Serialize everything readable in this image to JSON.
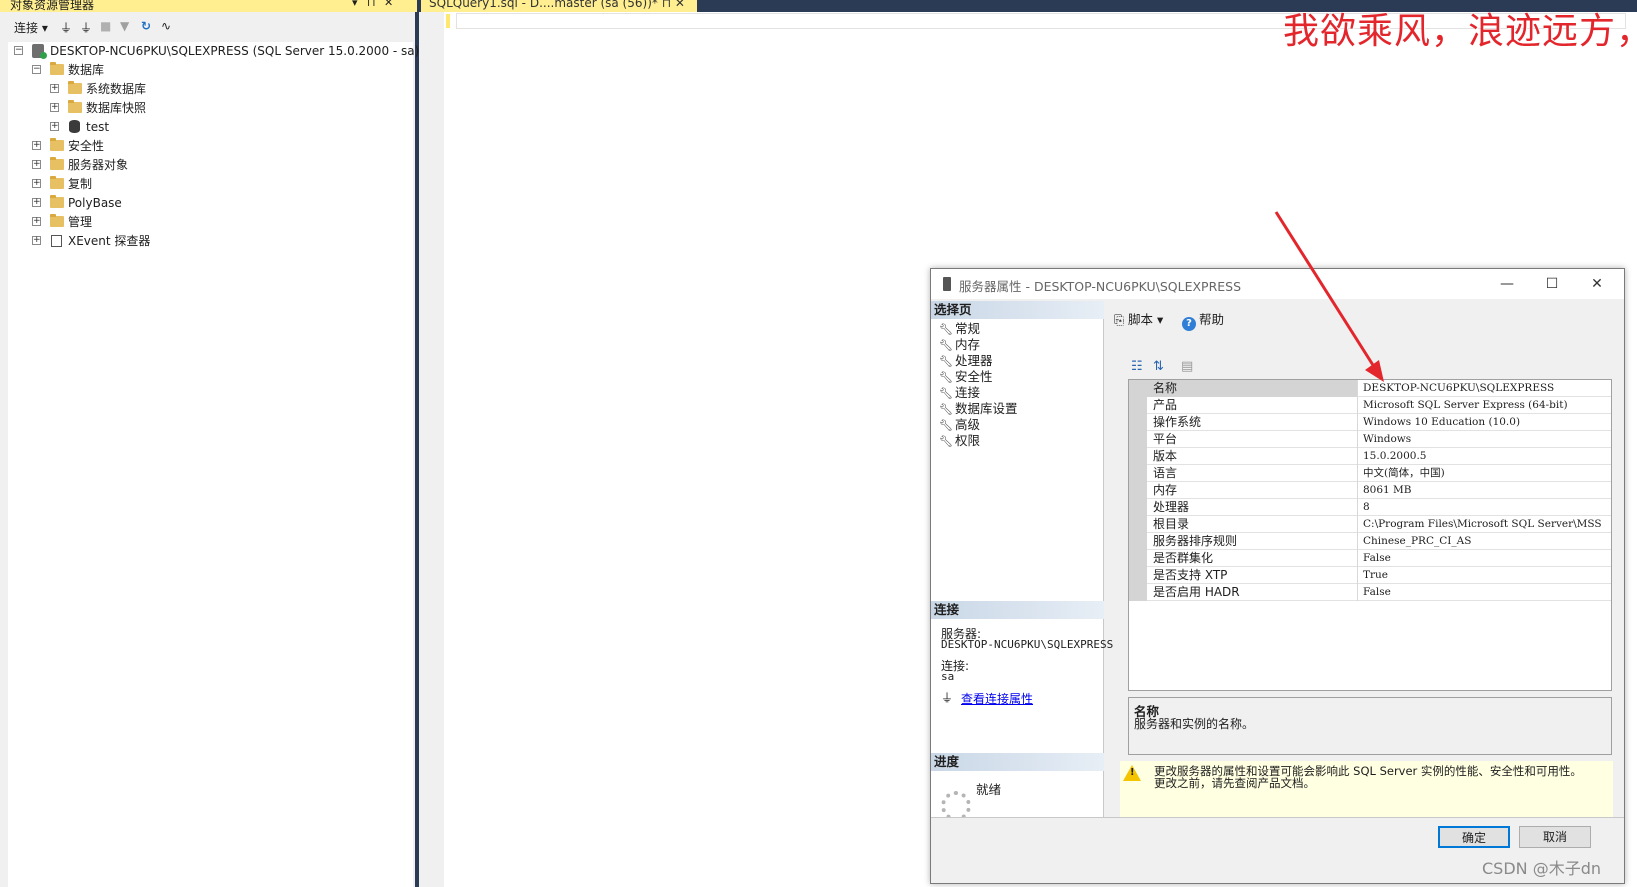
{
  "object_explorer": {
    "title": "对象资源管理器",
    "controls": [
      "▾",
      "⊓",
      "✕"
    ],
    "toolbar": {
      "connect_label": "连接 ▾"
    },
    "tree": {
      "server": "DESKTOP-NCU6PKU\\SQLEXPRESS (SQL Server 15.0.2000 - sa)",
      "databases": "数据库",
      "system_db": "系统数据库",
      "snapshots": "数据库快照",
      "test_db": "test",
      "security": "安全性",
      "server_objects": "服务器对象",
      "replication": "复制",
      "polybase": "PolyBase",
      "management": "管理",
      "xevent": "XEvent 探查器"
    }
  },
  "editor": {
    "tab_label": "SQLQuery1.sql - D....master (sa (56))*  ⊓  ✕"
  },
  "watermark": "我欲乘风，浪迹远方，",
  "csdn": "CSDN @木子dn",
  "dialog": {
    "title": "服务器属性 - DESKTOP-NCU6PKU\\SQLEXPRESS",
    "window_buttons": {
      "minimize": "—",
      "maximize": "☐",
      "close": "✕"
    },
    "select_page_header": "选择页",
    "pages": [
      "常规",
      "内存",
      "处理器",
      "安全性",
      "连接",
      "数据库设置",
      "高级",
      "权限"
    ],
    "connection_header": "连接",
    "server_label": "服务器:",
    "server_value": "DESKTOP-NCU6PKU\\SQLEXPRESS",
    "connection_label": "连接:",
    "connection_value": "sa",
    "view_connection_link": "查看连接属性",
    "progress_header": "进度",
    "progress_status": "就绪",
    "toolbar": {
      "script": "脚本",
      "help": "帮助"
    },
    "properties": [
      {
        "name": "名称",
        "value": "DESKTOP-NCU6PKU\\SQLEXPRESS"
      },
      {
        "name": "产品",
        "value": "Microsoft SQL Server Express (64-bit)"
      },
      {
        "name": "操作系统",
        "value": "Windows 10 Education (10.0)"
      },
      {
        "name": "平台",
        "value": "Windows"
      },
      {
        "name": "版本",
        "value": "15.0.2000.5"
      },
      {
        "name": "语言",
        "value": "中文(简体，中国)"
      },
      {
        "name": "内存",
        "value": "8061 MB"
      },
      {
        "name": "处理器",
        "value": "8"
      },
      {
        "name": "根目录",
        "value": "C:\\Program Files\\Microsoft SQL Server\\MSS"
      },
      {
        "name": "服务器排序规则",
        "value": "Chinese_PRC_CI_AS"
      },
      {
        "name": "是否群集化",
        "value": "False"
      },
      {
        "name": "是否支持 XTP",
        "value": "True"
      },
      {
        "name": "是否启用 HADR",
        "value": "False"
      }
    ],
    "description": {
      "title": "名称",
      "text": "服务器和实例的名称。"
    },
    "warning_lines": [
      "更改服务器的属性和设置可能会影响此 SQL Server 实例的性能、安全性和可用性。",
      "更改之前，请先查阅产品文档。"
    ],
    "ok_button": "确定",
    "cancel_button": "取消"
  },
  "colors": {
    "annotation_red": "#e3262c",
    "tab_yellow": "#ffef91",
    "chrome_dark": "#2b3a55"
  }
}
